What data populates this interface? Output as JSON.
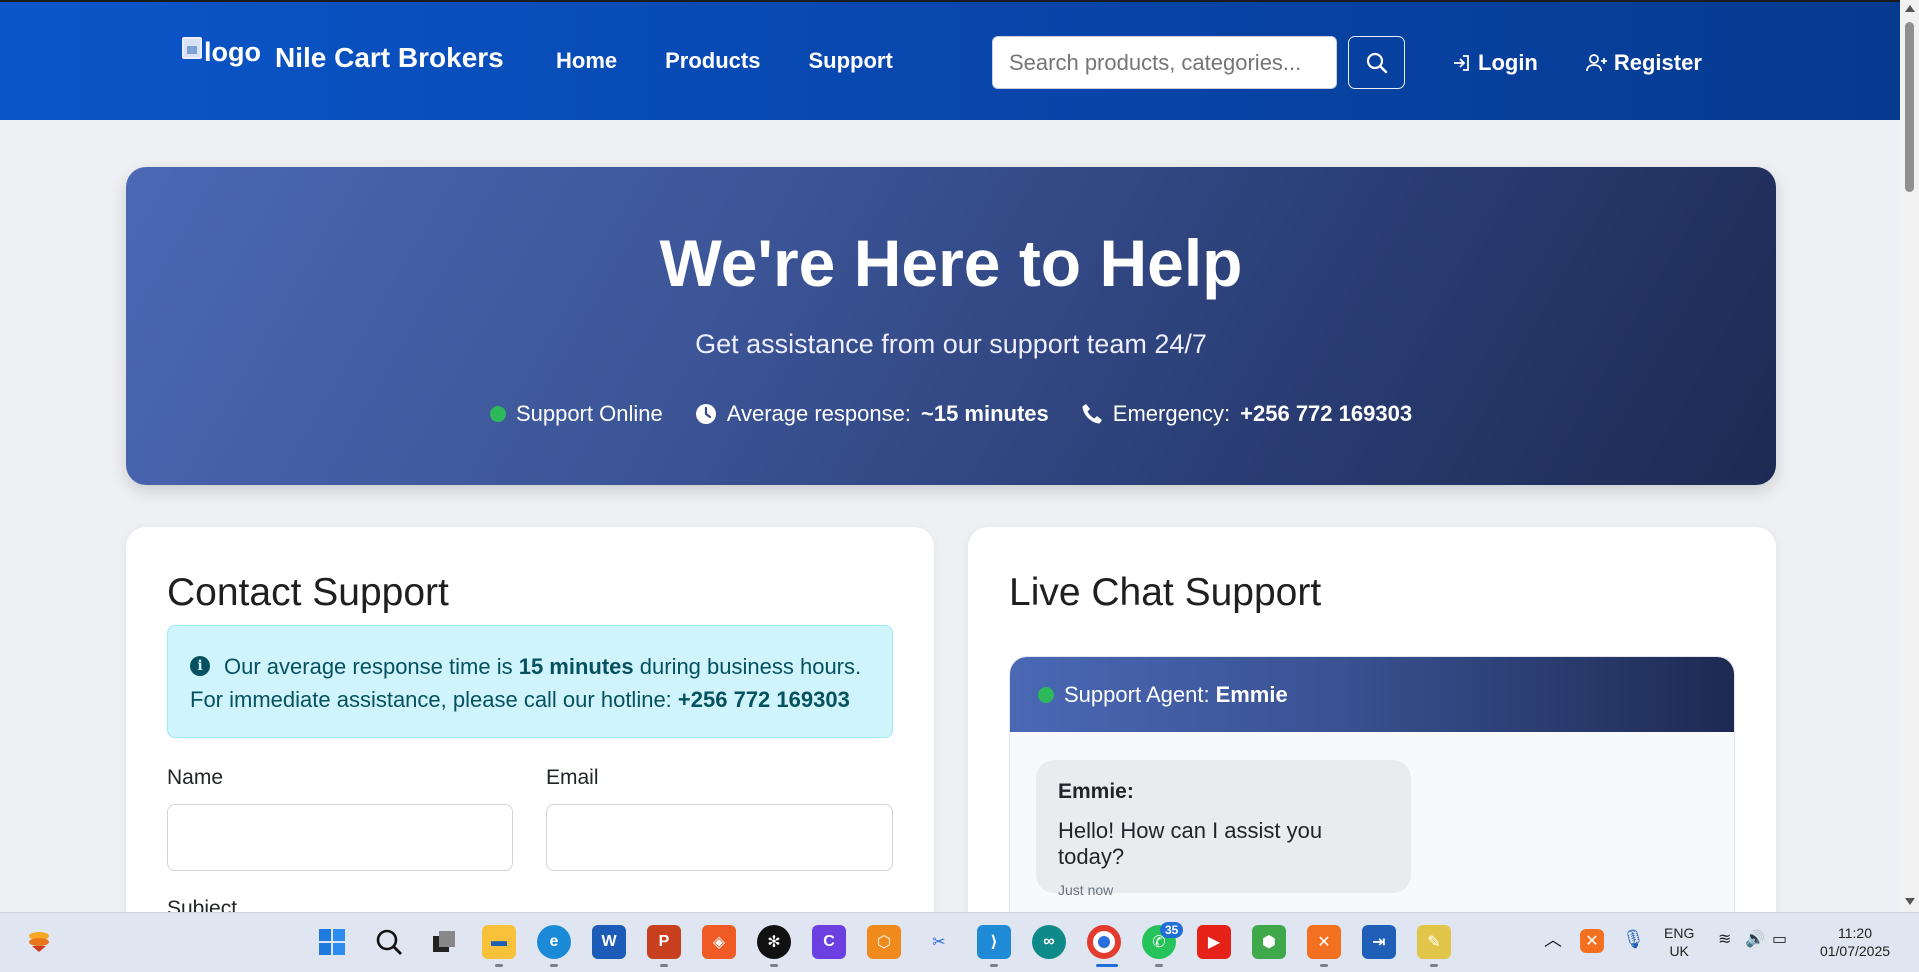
{
  "nav": {
    "logo_alt": "logo",
    "brand": "Nile Cart Brokers",
    "links": [
      "Home",
      "Products",
      "Support"
    ],
    "search_placeholder": "Search products, categories...",
    "login": "Login",
    "register": "Register"
  },
  "hero": {
    "title": "We're Here to Help",
    "subtitle": "Get assistance from our support team 24/7",
    "status": "Support Online",
    "response_label": "Average response:",
    "response_value": "~15 minutes",
    "emergency_label": "Emergency:",
    "emergency_value": "+256 772 169303"
  },
  "contact": {
    "title": "Contact Support",
    "alert_part1": "Our average response time is",
    "alert_bold1": "15 minutes",
    "alert_part2": "during business hours.",
    "alert_part3": "For immediate assistance, please call our hotline:",
    "alert_bold2": "+256 772 169303",
    "name_label": "Name",
    "email_label": "Email",
    "subject_label": "Subject"
  },
  "chat": {
    "title": "Live Chat Support",
    "agent_label": "Support Agent:",
    "agent_name": "Emmie",
    "msg_sender": "Emmie:",
    "msg_text": "Hello! How can I assist you today?",
    "msg_time": "Just now"
  },
  "taskbar": {
    "whatsapp_badge": "35",
    "lang": "ENG",
    "region": "UK",
    "time": "11:20",
    "date": "01/07/2025"
  },
  "colors": {
    "navbar": "#0848b0",
    "hero_start": "#4a68b5",
    "hero_end": "#1d2a52",
    "online_dot": "#2eb85c",
    "alert_bg": "#cff4fc"
  }
}
